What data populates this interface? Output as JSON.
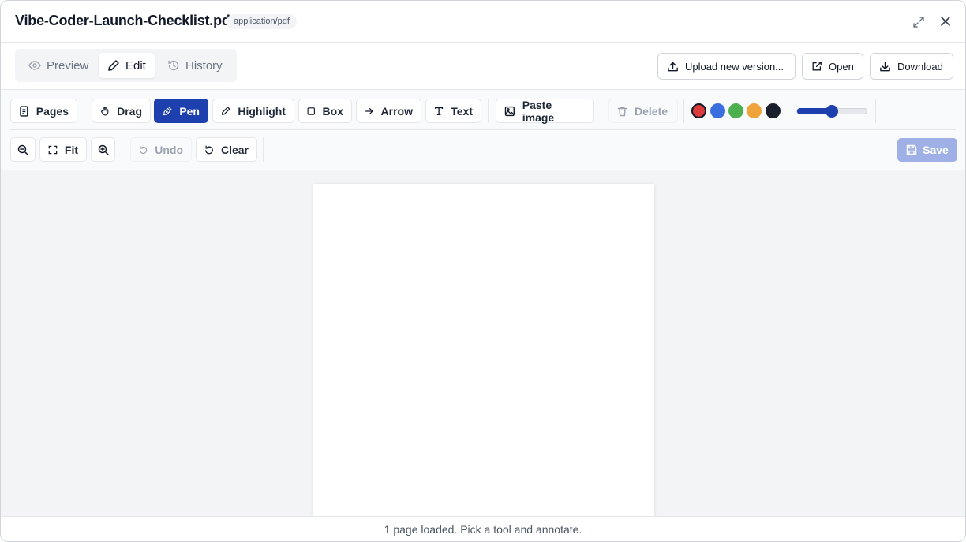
{
  "header": {
    "title": "Vibe-Coder-Launch-Checklist.pdf",
    "mime_type": "application/pdf",
    "expand_icon": "expand-icon",
    "close_icon": "close-icon"
  },
  "modes": {
    "preview": "Preview",
    "edit": "Edit",
    "history": "History",
    "active": "Edit"
  },
  "actions": {
    "upload": "Upload new version...",
    "open": "Open",
    "download": "Download"
  },
  "tools": {
    "pages": "Pages",
    "drag": "Drag",
    "pen": "Pen",
    "highlight": "Highlight",
    "box": "Box",
    "arrow": "Arrow",
    "text": "Text",
    "paste_image": "Paste image",
    "delete": "Delete",
    "active_tool": "Pen"
  },
  "colors": {
    "swatches": [
      "#dc3b3b",
      "#3b6fe0",
      "#4caf50",
      "#f0a23b",
      "#1a1f2e"
    ],
    "selected": "#dc3b3b",
    "accent": "#1e40af"
  },
  "stroke_width": {
    "fraction": 0.5
  },
  "view": {
    "fit": "Fit",
    "undo": "Undo",
    "clear": "Clear",
    "save": "Save"
  },
  "status": {
    "message": "1 page loaded. Pick a tool and annotate."
  }
}
